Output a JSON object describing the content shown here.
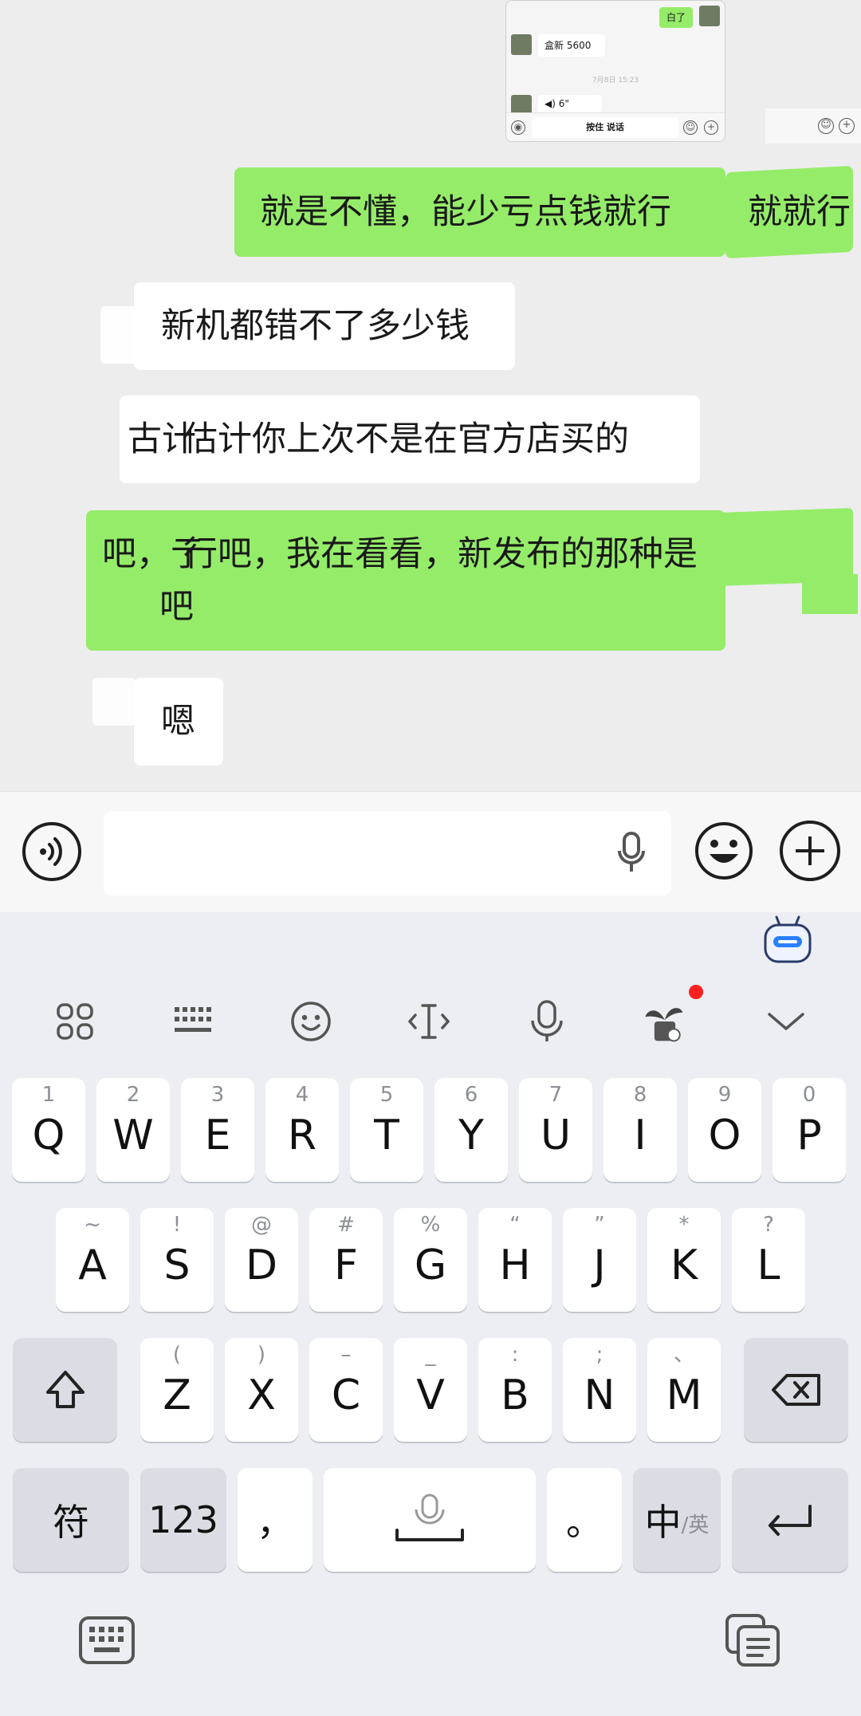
{
  "preview": {
    "sent_label": "白了",
    "price_text": "盒新 5600",
    "time_text": "7月8日 15:23",
    "voice_len": "6\"",
    "talk_label": "按住 说话"
  },
  "messages": [
    {
      "side": "right",
      "text": "就是不懂，能少亏点钱就行",
      "ghost": "就就行"
    },
    {
      "side": "left",
      "text": "新机都错不了多少钱"
    },
    {
      "side": "left",
      "text": "估计你上次不是在官方店买的",
      "ghost": "古计"
    },
    {
      "side": "right",
      "text": "行吧，我在看看，新发布的那种是",
      "text2": "吧",
      "ghost": "吧，亍"
    },
    {
      "side": "left",
      "text": "嗯"
    }
  ],
  "keyboard": {
    "row1": [
      {
        "main": "Q",
        "sec": "1"
      },
      {
        "main": "W",
        "sec": "2"
      },
      {
        "main": "E",
        "sec": "3"
      },
      {
        "main": "R",
        "sec": "4"
      },
      {
        "main": "T",
        "sec": "5"
      },
      {
        "main": "Y",
        "sec": "6"
      },
      {
        "main": "U",
        "sec": "7"
      },
      {
        "main": "I",
        "sec": "8"
      },
      {
        "main": "O",
        "sec": "9"
      },
      {
        "main": "P",
        "sec": "0"
      }
    ],
    "row2": [
      {
        "main": "A",
        "sec": "~"
      },
      {
        "main": "S",
        "sec": "!"
      },
      {
        "main": "D",
        "sec": "@"
      },
      {
        "main": "F",
        "sec": "#"
      },
      {
        "main": "G",
        "sec": "%"
      },
      {
        "main": "H",
        "sec": "“"
      },
      {
        "main": "J",
        "sec": "”"
      },
      {
        "main": "K",
        "sec": "*"
      },
      {
        "main": "L",
        "sec": "?"
      }
    ],
    "row3": [
      {
        "main": "Z",
        "sec": "("
      },
      {
        "main": "X",
        "sec": ")"
      },
      {
        "main": "C",
        "sec": "–"
      },
      {
        "main": "V",
        "sec": "_"
      },
      {
        "main": "B",
        "sec": ":"
      },
      {
        "main": "N",
        "sec": ";"
      },
      {
        "main": "M",
        "sec": "、"
      }
    ],
    "symbol_key": "符",
    "num_key": "123",
    "comma_key": "，",
    "period_key": "。",
    "lang_main": "中",
    "lang_alt": "/英"
  },
  "icons": {
    "voice": "voice-input-icon",
    "emoji": "emoji-icon",
    "plus": "plus-icon",
    "mic": "microphone-icon",
    "robot": "ai-assistant-icon"
  },
  "colors": {
    "sent_bubble": "#95ec69",
    "received_bubble": "#ffffff",
    "chat_bg": "#ededed",
    "keyboard_bg": "#eceef3",
    "notify_dot": "#ff1f1f",
    "robot_blue": "#2a7fff"
  }
}
